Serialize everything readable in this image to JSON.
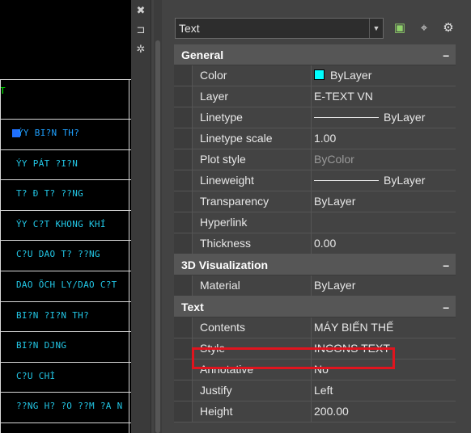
{
  "canvas": {
    "green_marker": "T",
    "items": [
      {
        "text": "ÝY BI?N TH?",
        "selected": true
      },
      {
        "text": "ÝY PÁT ?I?N",
        "selected": false
      },
      {
        "text": "T? Ð T? ??NG",
        "selected": false
      },
      {
        "text": "ÝY C?T KHONG KHÍ",
        "selected": false
      },
      {
        "text": "C?U DAO T? ??NG",
        "selected": false
      },
      {
        "text": "DAO ÕCH LY/DAO C?T",
        "selected": false
      },
      {
        "text": "BI?N ?I?N TH?",
        "selected": false
      },
      {
        "text": "BI?N DJNG",
        "selected": false
      },
      {
        "text": "C?U CHÌ",
        "selected": false
      },
      {
        "text": "??NG H? ?O ??M ?A N",
        "selected": false
      }
    ],
    "text_color": "#22c7e6"
  },
  "palette": {
    "strip_icons": [
      "close-icon",
      "auto-hide-icon",
      "settings-icon"
    ],
    "object_type": "Text",
    "toolbar_icons": [
      "toggle-pickadd-icon",
      "select-objects-icon",
      "quick-select-icon"
    ],
    "sections": [
      {
        "title": "General",
        "collapse_symbol": "–",
        "rows": [
          {
            "label": "Color",
            "value": "ByLayer",
            "swatch": "#00ffff"
          },
          {
            "label": "Layer",
            "value": "E-TEXT VN"
          },
          {
            "label": "Linetype",
            "value": "ByLayer",
            "line_sample": true
          },
          {
            "label": "Linetype scale",
            "value": "1.00"
          },
          {
            "label": "Plot style",
            "value": "ByColor",
            "dim": true
          },
          {
            "label": "Lineweight",
            "value": "ByLayer",
            "line_sample": true
          },
          {
            "label": "Transparency",
            "value": "ByLayer"
          },
          {
            "label": "Hyperlink",
            "value": ""
          },
          {
            "label": "Thickness",
            "value": "0.00"
          }
        ]
      },
      {
        "title": "3D Visualization",
        "collapse_symbol": "–",
        "rows": [
          {
            "label": "Material",
            "value": "ByLayer"
          }
        ]
      },
      {
        "title": "Text",
        "collapse_symbol": "–",
        "rows": [
          {
            "label": "Contents",
            "value": "MÁY BIẾN THẾ"
          },
          {
            "label": "Style",
            "value": "INCONS TEXT",
            "highlighted": true
          },
          {
            "label": "Annotative",
            "value": "No"
          },
          {
            "label": "Justify",
            "value": "Left"
          },
          {
            "label": "Height",
            "value": "200.00"
          }
        ]
      }
    ],
    "highlight_color": "#e0141e"
  }
}
